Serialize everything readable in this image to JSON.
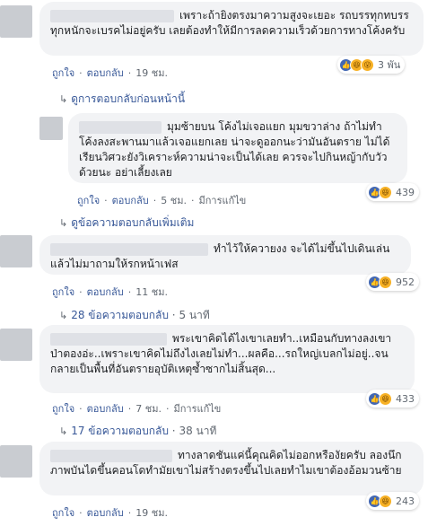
{
  "comments": [
    {
      "text": "เพราะถ้ายิงตรงมาความสูงจะเยอะ รถบรรทุกทบรรทุกหนักจะเบรคไม่อยู่ครับ เลยต้องทำให้มีการลดความเร็วด้วยการทางโค้งครับ",
      "like": "ถูกใจ",
      "reply": "ตอบกลับ",
      "time": "19 ชม.",
      "reactions": {
        "count": "3 พัน",
        "types": [
          "like-icon",
          "haha-icon",
          "wow-icon"
        ]
      },
      "more": "ดูการตอบกลับก่อนหน้านี้"
    },
    {
      "text": "มุมซ้ายบน โค้งไม่เจอแยก มุมขวาล่าง ถ้าไม่ทำโค้งลงสะพานมาแล้วเจอแยกเลย น่าจะดูออกนะว่ามันอันตราย ไม่ได้เรียนวิศวะยังวิเคราะห์ความน่าจะเป็นได้เลย ควรจะไปกินหญ้ากับวัวด้วยนะ อย่าเลี้ยงเลย",
      "like": "ถูกใจ",
      "reply": "ตอบกลับ",
      "time": "5 ชม.",
      "edited": "มีการแก้ไข",
      "reactions": {
        "count": "439",
        "types": [
          "like-icon",
          "haha-icon"
        ]
      },
      "more": "ดูข้อความตอบกลับเพิ่มเติม"
    },
    {
      "text": "ทำไว้ให้ควายงง จะได้ไม่ขึ้นไปเดินเล่น แล้วไม่มาถามให้รกหน้าเฟส",
      "like": "ถูกใจ",
      "reply": "ตอบกลับ",
      "time": "11 ชม.",
      "reactions": {
        "count": "952",
        "types": [
          "like-icon",
          "haha-icon"
        ]
      },
      "more": "28 ข้อความตอบกลับ",
      "more_time": "5 นาที"
    },
    {
      "text": "พระเขาคิดได้ไงเขาเลยทำ..เหมือนกับทางลงเขาป่าตองอ่ะ..เพราะเขาคิดไม่ถึงไงเลยไม่ทำ...ผลคือ...รถใหญ่เบลกไม่อยู่..จนกลายเป็นพื้นที่อันตรายอุบัติเหตุซ้ำซากไม่สิ้นสุด...",
      "like": "ถูกใจ",
      "reply": "ตอบกลับ",
      "time": "7 ชม.",
      "edited": "มีการแก้ไข",
      "reactions": {
        "count": "433",
        "types": [
          "like-icon",
          "haha-icon"
        ]
      },
      "more": "17 ข้อความตอบกลับ",
      "more_time": "38 นาที"
    },
    {
      "text": "ทางลาดชันแค่นี้คุณคิดไม่ออกหรืองัยครับ ลองนึกภาพบันไดขึ้นคอนโดทำมัยเขาไม่สร้างตรงขึ้นไปเลยทำไมเขาต้องอ้อมวนซ้าย",
      "like": "ถูกใจ",
      "reply": "ตอบกลับ",
      "time": "19 ชม.",
      "reactions": {
        "count": "243",
        "types": [
          "like-icon",
          "haha-icon"
        ]
      }
    }
  ]
}
